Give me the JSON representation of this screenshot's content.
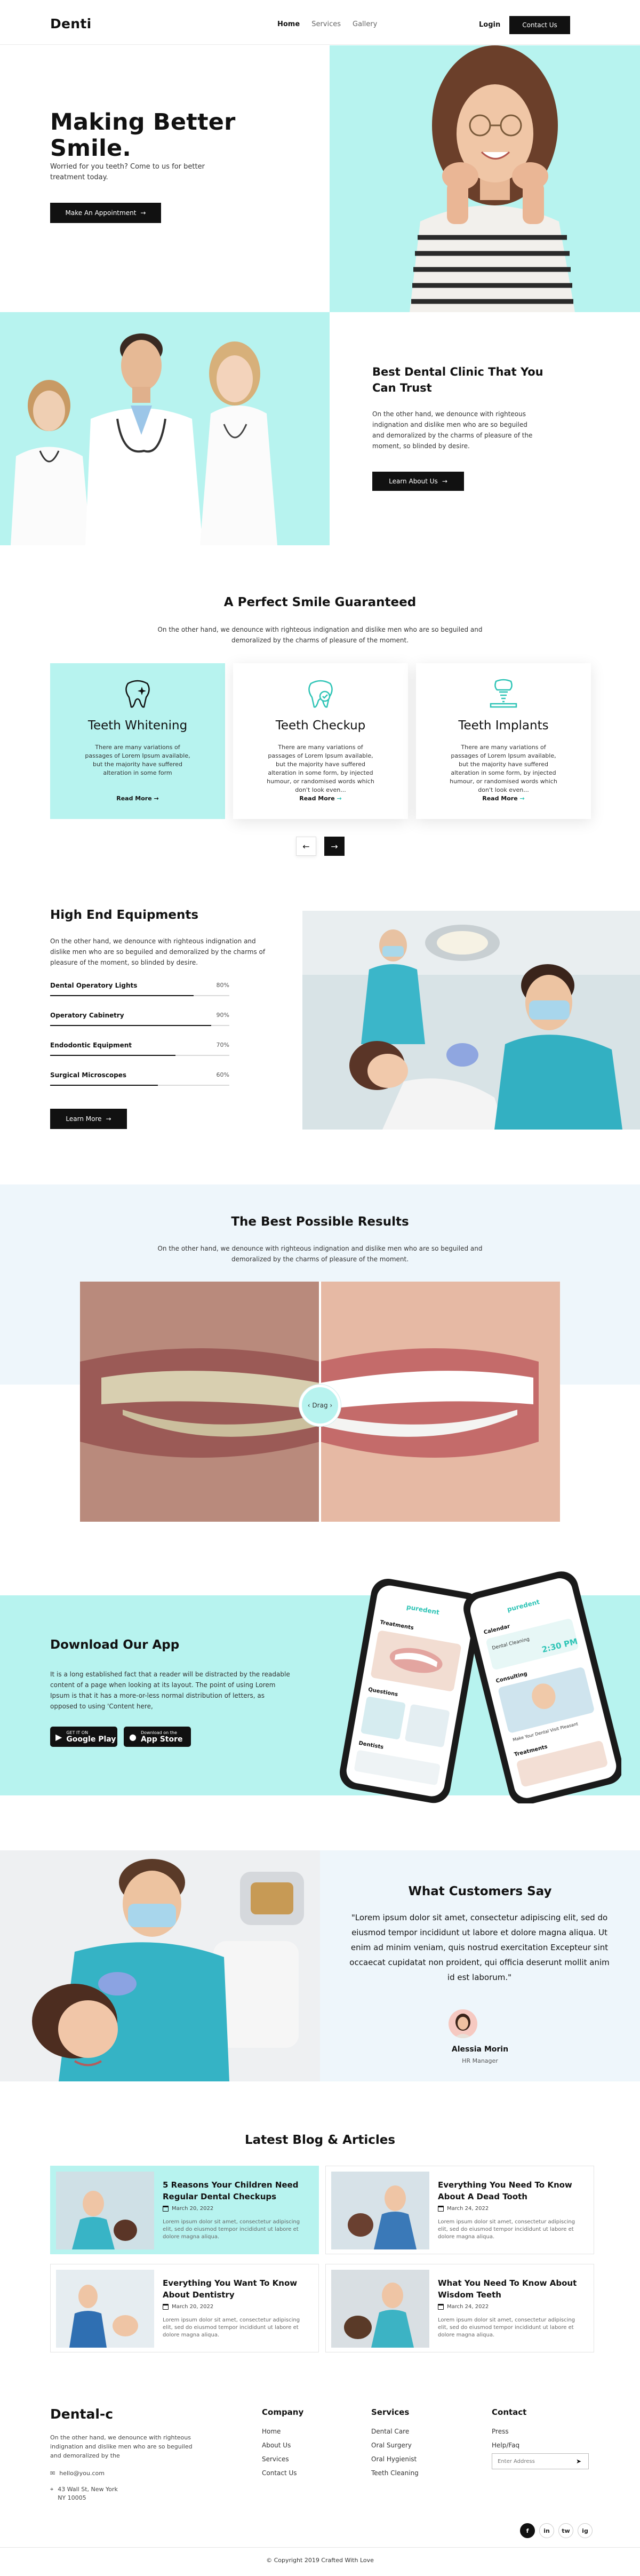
{
  "header": {
    "logo": "Denti",
    "nav": [
      "Home",
      "Services",
      "Gallery"
    ],
    "login": "Login",
    "contact_button": "Contact Us"
  },
  "hero": {
    "title_line1": "Making Better",
    "title_line2": "Smile.",
    "subtitle": "Worried for you teeth? Come to us for better treatment today.",
    "button": "Make An Appointment"
  },
  "about": {
    "title": "Best Dental Clinic That You Can Trust",
    "text": "On the other hand, we denounce with righteous indignation and dislike men who are so beguiled and demoralized by the charms of pleasure of the moment, so blinded by desire.",
    "button": "Learn About Us"
  },
  "services": {
    "title": "A Perfect Smile Guaranteed",
    "subtitle": "On the other hand, we denounce with righteous indignation and dislike men who are so beguiled and demoralized by the charms of pleasure of the moment.",
    "cards": [
      {
        "title": "Teeth Whitening",
        "text": "There are many variations of passages of Lorem Ipsum available, but the majority have suffered alteration in some form",
        "link": "Read More",
        "icon": "tooth-sparkle-icon"
      },
      {
        "title": "Teeth Checkup",
        "text": "There are many variations of passages of Lorem Ipsum available, but the majority have suffered alteration in some form, by injected humour, or randomised words which don't look even...",
        "link": "Read More",
        "icon": "tooth-check-icon"
      },
      {
        "title": "Teeth Implants",
        "text": "There are many variations of passages of Lorem Ipsum available, but the majority have suffered alteration in some form, by injected humour, or randomised words which don't look even...",
        "link": "Read More",
        "icon": "tooth-implant-icon"
      }
    ],
    "accent_color": "#2ec4b6"
  },
  "equipment": {
    "title": "High End Equipments",
    "text": "On the other hand, we denounce with righteous indignation and dislike men who are so beguiled and demoralized by the charms of pleasure of the moment, so blinded by desire.",
    "items": [
      {
        "label": "Dental Operatory Lights",
        "pct_text": "80%",
        "value": 0.8
      },
      {
        "label": "Operatory Cabinetry",
        "pct_text": "90%",
        "value": 0.9
      },
      {
        "label": "Endodontic Equipment",
        "pct_text": "70%",
        "value": 0.7
      },
      {
        "label": "Surgical Microscopes",
        "pct_text": "60%",
        "value": 0.6
      }
    ],
    "button": "Learn More"
  },
  "results": {
    "title": "The Best Possible Results",
    "subtitle": "On the other hand, we denounce with righteous indignation and dislike men who are so beguiled and demoralized by the charms of pleasure of the moment.",
    "drag_label": "Drag"
  },
  "app": {
    "title": "Download Our App",
    "text": "It is a long established fact that a reader will be distracted by the readable content of a page when looking at its layout. The point of using Lorem Ipsum is that it has a more-or-less normal distribution of letters, as opposed to using 'Content here,",
    "google_small": "GET IT ON",
    "google_big": "Google Play",
    "apple_small": "Download on the",
    "apple_big": "App Store",
    "phone_back": {
      "brand": "puredent",
      "heading": "Treatments",
      "label1": "Questions",
      "label2": "Dentists"
    },
    "phone_front": {
      "brand": "puredent",
      "header": "Calendar",
      "item1": "Dental Cleaning",
      "time": "2:30 PM",
      "section": "Consulting",
      "item2": "Make Your Dental Visit Pleasant",
      "section2": "Treatments"
    }
  },
  "testimonial": {
    "title": "What Customers Say",
    "quote": "\"Lorem ipsum dolor sit amet, consectetur adipiscing elit, sed do eiusmod tempor incididunt ut labore et dolore magna aliqua. Ut enim ad minim veniam, quis nostrud exercitation Excepteur sint occaecat cupidatat non proident, qui officia deserunt mollit anim id est laborum.\"",
    "name": "Alessia Morin",
    "role": "HR Manager"
  },
  "blog": {
    "title": "Latest Blog & Articles",
    "posts": [
      {
        "title": "5 Reasons Your Children Need Regular Dental Checkups",
        "date": "March 20, 2022",
        "text": "Lorem ipsum dolor sit amet, consectetur adipiscing elit, sed do eiusmod tempor incididunt ut labore et dolore magna aliqua."
      },
      {
        "title": "Everything You Need To Know About A Dead Tooth",
        "date": "March 24, 2022",
        "text": "Lorem ipsum dolor sit amet, consectetur adipiscing elit, sed do eiusmod tempor incididunt ut labore et dolore magna aliqua."
      },
      {
        "title": "Everything You Want To Know About Dentistry",
        "date": "March 20, 2022",
        "text": "Lorem ipsum dolor sit amet, consectetur adipiscing elit, sed do eiusmod tempor incididunt ut labore et dolore magna aliqua."
      },
      {
        "title": "What You Need To Know About Wisdom Teeth",
        "date": "March 24, 2022",
        "text": "Lorem ipsum dolor sit amet, consectetur adipiscing elit, sed do eiusmod tempor incididunt ut labore et dolore magna aliqua."
      }
    ]
  },
  "footer": {
    "logo": "Dental-c",
    "text": "On the other hand, we denounce with righteous indignation and dislike men who are so beguiled and demoralized by the",
    "email": "hello@you.com",
    "address_line1": "43 Wall St, New York",
    "address_line2": "NY 10005",
    "company_heading": "Company",
    "company_links": [
      "Home",
      "About Us",
      "Services",
      "Contact Us"
    ],
    "services_heading": "Services",
    "services_links": [
      "Dental Care",
      "Oral Surgery",
      "Oral Hygienist",
      "Teeth Cleaning"
    ],
    "contact_heading": "Contact",
    "contact_links": [
      "Press",
      "Help/Faq"
    ],
    "email_placeholder": "Enter Address",
    "social": [
      "f",
      "in",
      "tw",
      "ig"
    ],
    "copyright": "© Copyright 2019 Crafted With Love"
  }
}
